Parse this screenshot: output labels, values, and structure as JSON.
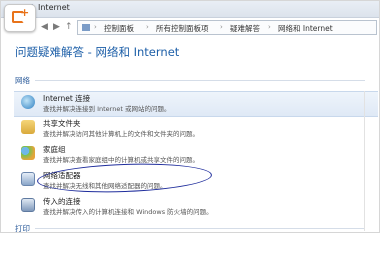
{
  "window": {
    "title": "Internet"
  },
  "logo": {
    "name": "plus-logo-icon"
  },
  "address": {
    "crumbs": [
      "控制面板",
      "所有控制面板项",
      "疑难解答",
      "网络和 Internet"
    ]
  },
  "page": {
    "title": "问题疑难解答 - 网络和 Internet"
  },
  "sections": {
    "network": "网络",
    "printing": "打印"
  },
  "items": [
    {
      "title": "Internet 连接",
      "desc": "查找并解决连接到 Internet 或网站的问题。",
      "icon": "globe-icon"
    },
    {
      "title": "共享文件夹",
      "desc": "查找并解决访问其他计算机上的文件和文件夹的问题。",
      "icon": "shared-folder-icon"
    },
    {
      "title": "家庭组",
      "desc": "查找并解决查看家庭组中的计算机或共享文件的问题。",
      "icon": "homegroup-icon"
    },
    {
      "title": "网络适配器",
      "desc": "查找并解决无线和其他网络适配器的问题。",
      "icon": "network-adapter-icon"
    },
    {
      "title": "传入的连接",
      "desc": "查找并解决传入的计算机连接和 Windows 防火墙的问题。",
      "icon": "incoming-connection-icon"
    }
  ],
  "colors": {
    "accent": "#1d5fa8",
    "highlight_ellipse": "#1f2d9c",
    "logo_orange": "#e8731a"
  }
}
